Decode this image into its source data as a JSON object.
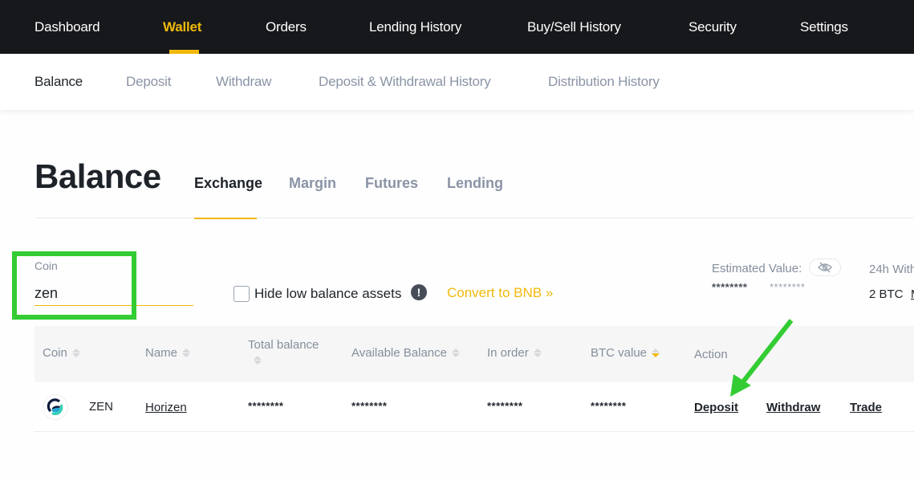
{
  "top_nav": {
    "items": [
      {
        "label": "Dashboard",
        "active": false
      },
      {
        "label": "Wallet",
        "active": true
      },
      {
        "label": "Orders",
        "active": false
      },
      {
        "label": "Lending History",
        "active": false
      },
      {
        "label": "Buy/Sell History",
        "active": false
      },
      {
        "label": "Security",
        "active": false
      },
      {
        "label": "Settings",
        "active": false
      }
    ]
  },
  "sub_nav": {
    "items": [
      {
        "label": "Balance",
        "active": true
      },
      {
        "label": "Deposit",
        "active": false
      },
      {
        "label": "Withdraw",
        "active": false
      },
      {
        "label": "Deposit & Withdrawal History",
        "active": false
      },
      {
        "label": "Distribution History",
        "active": false
      }
    ]
  },
  "page": {
    "title": "Balance",
    "tabs": [
      {
        "label": "Exchange",
        "active": true
      },
      {
        "label": "Margin",
        "active": false
      },
      {
        "label": "Futures",
        "active": false
      },
      {
        "label": "Lending",
        "active": false
      }
    ]
  },
  "filters": {
    "coin_label": "Coin",
    "coin_value": "zen",
    "hide_low_balance_label": "Hide low balance assets",
    "hide_low_balance_checked": false,
    "info_icon": "exclamation-icon",
    "convert_link": "Convert to BNB »"
  },
  "estimated_value": {
    "label": "Estimated Value:",
    "toggle_icon": "eye-off-icon",
    "btc_value": "********",
    "fiat_value": "********"
  },
  "withdrawal_limit": {
    "label": "24h With",
    "value": "2  BTC",
    "more_link": "M"
  },
  "table": {
    "columns": [
      {
        "label": "Coin",
        "sortable": true,
        "sort": "none"
      },
      {
        "label": "Name",
        "sortable": true,
        "sort": "none"
      },
      {
        "label": "Total balance",
        "sortable": true,
        "sort": "none"
      },
      {
        "label": "Available Balance",
        "sortable": true,
        "sort": "none"
      },
      {
        "label": "In order",
        "sortable": true,
        "sort": "none"
      },
      {
        "label": "BTC value",
        "sortable": true,
        "sort": "desc"
      },
      {
        "label": "Action",
        "sortable": false
      }
    ],
    "rows": [
      {
        "coin": "ZEN",
        "name": "Horizen",
        "total_balance": "********",
        "available_balance": "********",
        "in_order": "********",
        "btc_value": "********",
        "actions": [
          "Deposit",
          "Withdraw",
          "Trade"
        ]
      }
    ]
  },
  "annotations": {
    "highlight_color": "#33cc33",
    "arrow_color": "#33cc33"
  },
  "colors": {
    "accent": "#f0b90b",
    "nav_bg": "#17181c",
    "muted_text": "#848e9c"
  }
}
